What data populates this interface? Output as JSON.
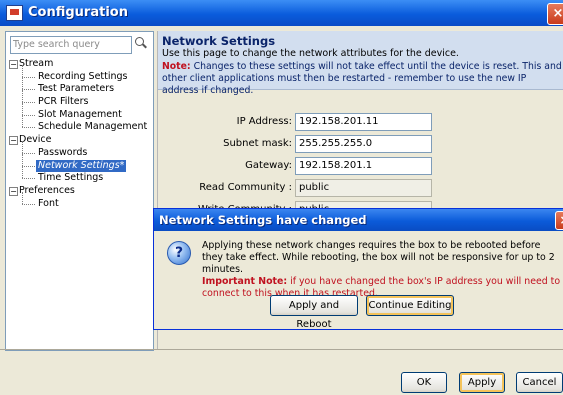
{
  "window": {
    "title": "Configuration"
  },
  "search": {
    "placeholder": "Type search query"
  },
  "tree": {
    "stream": "Stream",
    "recording": "Recording Settings",
    "test": "Test Parameters",
    "pcr": "PCR Filters",
    "slot": "Slot Management",
    "schedule": "Schedule Management",
    "device": "Device",
    "passwords": "Passwords",
    "network": "Network Settings*",
    "time": "Time Settings",
    "preferences": "Preferences",
    "font": "Font",
    "expand_sign": "−"
  },
  "page": {
    "title": "Network Settings",
    "description": "Use this page to change the network attributes for the device.",
    "note_label": "Note:",
    "note_text": " Changes to these settings will not take effect until the device is reset. This and other client applications must then be restarted - remember to use the new IP address if changed."
  },
  "form": {
    "ip_label": "IP Address:",
    "ip_value": "192.158.201.11",
    "mask_label": "Subnet mask:",
    "mask_value": "255.255.255.0",
    "gateway_label": "Gateway:",
    "gateway_value": "192.158.201.1",
    "read_label": "Read Community :",
    "read_value": "public",
    "write_label": "Write Community :",
    "write_value": "public"
  },
  "dialog": {
    "title": "Network Settings have changed",
    "message": "Applying these network changes requires the box to be rebooted before they take effect. While rebooting, the box will not be responsive for up to 2 minutes.",
    "important_label": "Important Note:",
    "important_text": " if you have changed the box's IP address you will need to connect to this when it has restarted.",
    "apply_reboot": "Apply and Reboot",
    "continue_editing": "Continue Editing",
    "icon_glyph": "?"
  },
  "buttons": {
    "ok": "OK",
    "apply": "Apply",
    "cancel": "Cancel"
  },
  "icons": {
    "close": "×"
  }
}
